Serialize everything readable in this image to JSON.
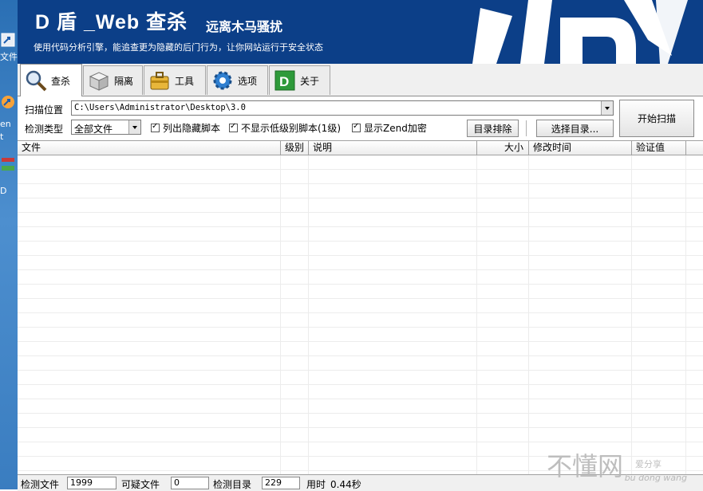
{
  "desktop": {
    "labels": [
      "文件",
      "en",
      "t",
      "D"
    ]
  },
  "banner": {
    "title": "D 盾 _Web 查杀",
    "tagline": "远离木马骚扰",
    "description": "使用代码分析引擎，能追查更为隐藏的后门行为，让你网站运行于安全状态",
    "bg_color": "#0c3f88"
  },
  "tabs": [
    {
      "label": "查杀",
      "icon": "magnifier-icon",
      "active": true
    },
    {
      "label": "隔离",
      "icon": "box-icon",
      "active": false
    },
    {
      "label": "工具",
      "icon": "toolbox-icon",
      "active": false
    },
    {
      "label": "选项",
      "icon": "gear-icon",
      "active": false
    },
    {
      "label": "关于",
      "icon": "d-logo-icon",
      "active": false
    }
  ],
  "scan": {
    "location_label": "扫描位置",
    "path_value": "C:\\Users\\Administrator\\Desktop\\3.0",
    "type_label": "检测类型",
    "type_value": "全部文件",
    "options": [
      {
        "label": "列出隐藏脚本",
        "checked": true
      },
      {
        "label": "不显示低级别脚本(1级)",
        "checked": true
      },
      {
        "label": "显示Zend加密",
        "checked": true
      }
    ],
    "exclude_dir_button": "目录排除",
    "select_dir_button": "选择目录...",
    "start_scan_button": "开始扫描"
  },
  "table": {
    "columns": [
      "文件",
      "级别",
      "说明",
      "大小",
      "修改时间",
      "验证值"
    ],
    "rows": []
  },
  "status": {
    "items": [
      {
        "label": "检测文件",
        "value": "1999"
      },
      {
        "label": "可疑文件",
        "value": "0"
      },
      {
        "label": "检测目录",
        "value": "229"
      },
      {
        "label": "用时",
        "value": "0.44秒"
      }
    ]
  },
  "watermark": {
    "main": "不懂网",
    "sub": "爱分享",
    "pinyin": "bu dong wang"
  }
}
